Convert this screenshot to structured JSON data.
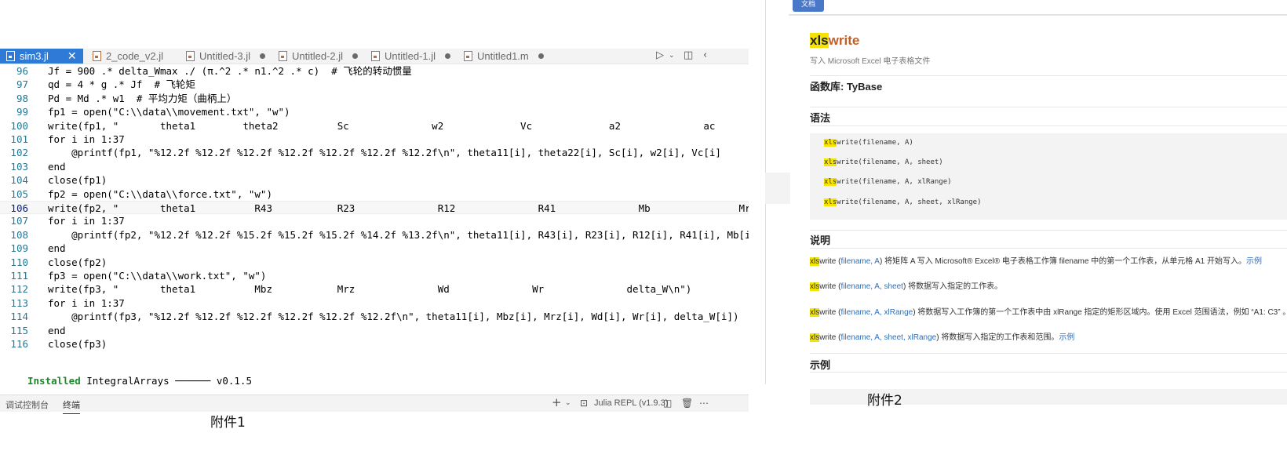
{
  "editor": {
    "tabs": [
      {
        "label": "sim3.jl",
        "active": true
      },
      {
        "label": "2_code_v2.jl",
        "active": false
      },
      {
        "label": "Untitled-3.jl",
        "active": false
      },
      {
        "label": "Untitled-2.jl",
        "active": false
      },
      {
        "label": "Untitled-1.jl",
        "active": false
      },
      {
        "label": "Untitled1.m",
        "active": false
      }
    ],
    "lines": [
      {
        "n": "96",
        "code": "Jf = 900 .* delta_Wmax ./ (π.^2 .* n1.^2 .* c)  # 飞轮的转动惯量"
      },
      {
        "n": "97",
        "code": "qd = 4 * g .* Jf  # 飞轮矩"
      },
      {
        "n": "98",
        "code": "Pd = Md .* w1  # 平均力矩（曲柄上）"
      },
      {
        "n": "99",
        "code": "fp1 = open(\"C:\\\\data\\\\movement.txt\", \"w\")"
      },
      {
        "n": "100",
        "code": "write(fp1, \"       theta1        theta2          Sc              w2             Vc             a2              ac"
      },
      {
        "n": "101",
        "code": "for i in 1:37"
      },
      {
        "n": "102",
        "code": "    @printf(fp1, \"%12.2f %12.2f %12.2f %12.2f %12.2f %12.2f %12.2f\\n\", theta11[i], theta22[i], Sc[i], w2[i], Vc[i]"
      },
      {
        "n": "103",
        "code": "end"
      },
      {
        "n": "104",
        "code": "close(fp1)"
      },
      {
        "n": "105",
        "code": "fp2 = open(\"C:\\\\data\\\\force.txt\", \"w\")"
      },
      {
        "n": "106",
        "code": "write(fp2, \"       theta1          R43           R23              R12              R41              Mb               Mr\\n\")"
      },
      {
        "n": "107",
        "code": "for i in 1:37"
      },
      {
        "n": "108",
        "code": "    @printf(fp2, \"%12.2f %12.2f %15.2f %15.2f %15.2f %14.2f %13.2f\\n\", theta11[i], R43[i], R23[i], R12[i], R41[i], Mb[i],"
      },
      {
        "n": "109",
        "code": "end"
      },
      {
        "n": "110",
        "code": "close(fp2)"
      },
      {
        "n": "111",
        "code": "fp3 = open(\"C:\\\\data\\\\work.txt\", \"w\")"
      },
      {
        "n": "112",
        "code": "write(fp3, \"       theta1          Mbz           Mrz              Wd              Wr              delta_W\\n\")"
      },
      {
        "n": "113",
        "code": "for i in 1:37"
      },
      {
        "n": "114",
        "code": "    @printf(fp3, \"%12.2f %12.2f %12.2f %12.2f %12.2f %12.2f\\n\", theta11[i], Mbz[i], Mrz[i], Wd[i], Wr[i], delta_W[i])"
      },
      {
        "n": "115",
        "code": "end"
      },
      {
        "n": "116",
        "code": "close(fp3)"
      }
    ],
    "current_line": "106",
    "panel_tabs": {
      "debug": "调试控制台",
      "terminal": "终端"
    },
    "repl_label": "Julia REPL (v1.9.3)",
    "terminal_keyword": "Installed",
    "terminal_rest": " IntegralArrays ────── v0.1.5",
    "caption": "附件1"
  },
  "doc": {
    "top_button": "文档",
    "title_hl": "xls",
    "title_rest": "write",
    "subtitle": "写入 Microsoft Excel 电子表格文件",
    "library": "函数库: TyBase",
    "syntax_heading": "语法",
    "syntax": [
      {
        "hl": "xls",
        "rest": "write(filename, A)"
      },
      {
        "hl": "xls",
        "rest": "write(filename, A, sheet)"
      },
      {
        "hl": "xls",
        "rest": "write(filename, A, xlRange)"
      },
      {
        "hl": "xls",
        "rest": "write(filename, A, sheet, xlRange)"
      }
    ],
    "desc_heading": "说明",
    "desc": [
      {
        "hl": "xls",
        "fn": "write (",
        "args": "filename, A",
        "close": ")",
        "text": " 将矩阵 A 写入 Microsoft® Excel® 电子表格工作簿 filename 中的第一个工作表，从单元格 A1 开始写入。",
        "link": "示例"
      },
      {
        "hl": "xls",
        "fn": "write (",
        "args": "filename, A, sheet",
        "close": ")",
        "text": " 将数据写入指定的工作表。",
        "link": ""
      },
      {
        "hl": "xls",
        "fn": "write (",
        "args": "filename, A, xlRange",
        "close": ")",
        "text": " 将数据写入工作簿的第一个工作表中由 xlRange 指定的矩形区域内。使用 Excel 范围语法，例如 “A1: C3” 。",
        "link": ""
      },
      {
        "hl": "xls",
        "fn": "write (",
        "args": "filename, A, sheet, xlRange",
        "close": ")",
        "text": " 将数据写入指定的工作表和范围。",
        "link": "示例"
      }
    ],
    "example_heading": "示例",
    "caption": "附件2"
  }
}
